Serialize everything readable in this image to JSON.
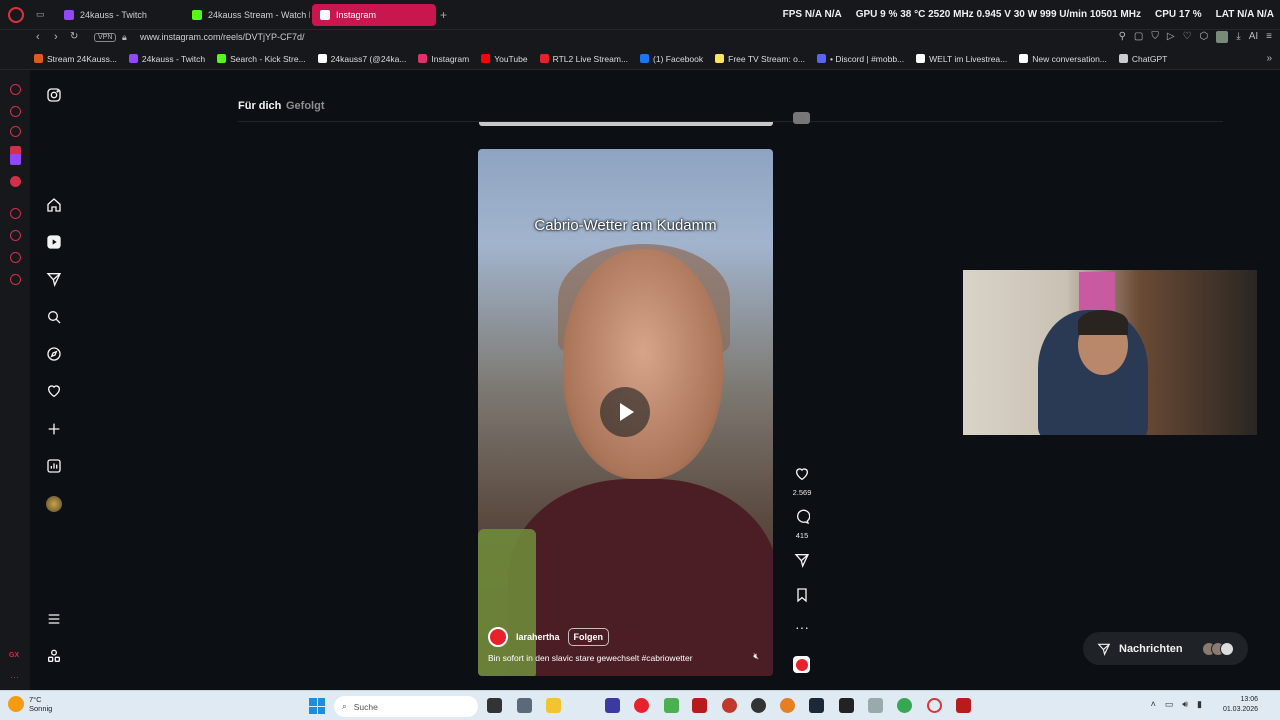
{
  "tabs": [
    {
      "label": "24kauss - Twitch",
      "color": "#9146ff"
    },
    {
      "label": "24kauss Stream - Watch L",
      "color": "#53fc18"
    },
    {
      "label": "Instagram",
      "color": "#e1306c",
      "active": true
    }
  ],
  "new_tab_label": "+",
  "stats": {
    "fps": "FPS  N/A  N/A",
    "gpu": "GPU  9 %  38 °C  2520 MHz  0.945 V  30 W  999 U/min  10501 MHz",
    "cpu": "CPU  17 %",
    "lat": "LAT  N/A  N/A"
  },
  "address": {
    "url": "www.instagram.com/reels/DVTjYP-CF7d/",
    "vpn_label": "VPN",
    "ai_label": "AI"
  },
  "bookmarks": [
    {
      "label": "Stream 24Kauss...",
      "color": "#e05a1a"
    },
    {
      "label": "24kauss - Twitch",
      "color": "#9146ff"
    },
    {
      "label": "Search - Kick Stre...",
      "color": "#53fc18"
    },
    {
      "label": "24kauss7 (@24ka...",
      "color": "#ffffff"
    },
    {
      "label": "Instagram",
      "color": "#e1306c"
    },
    {
      "label": "YouTube",
      "color": "#ff0000"
    },
    {
      "label": "RTL2 Live Stream...",
      "color": "#e8222d"
    },
    {
      "label": "(1) Facebook",
      "color": "#1877f2"
    },
    {
      "label": "Free TV Stream: o...",
      "color": "#ffe45c"
    },
    {
      "label": "• Discord | #mobb...",
      "color": "#5865f2"
    },
    {
      "label": "WELT im Livestrea...",
      "color": "#ffffff"
    },
    {
      "label": "New conversation...",
      "color": "#ffffff"
    },
    {
      "label": "ChatGPT",
      "color": "#cccccc"
    }
  ],
  "instagram": {
    "nav_for_you": "Für dich",
    "nav_following": "Gefolgt",
    "reel": {
      "caption_overlay": "Cabrio-Wetter am Kudamm",
      "username": "larahertha",
      "follow_label": "Folgen",
      "description": "Bin sofort in den slavic stare gewechselt #cabriowetter",
      "likes": "2.569",
      "comments": "415"
    },
    "messages_label": "Nachrichten"
  },
  "taskbar": {
    "temperature": "7°C",
    "weather": "Sonnig",
    "search_placeholder": "Suche",
    "time": "13:06",
    "date": "01.03.2026"
  }
}
